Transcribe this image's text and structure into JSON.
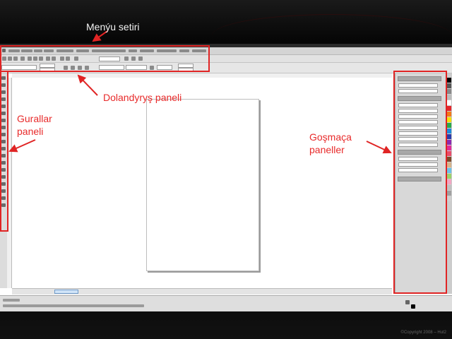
{
  "annotations": {
    "menu_label": "Menýu setiri",
    "toolbar_label": "Dolandyryş paneli",
    "toolbox_label_1": "Gurallar",
    "toolbox_label_2": "paneli",
    "dockers_label_1": "Goşmaça",
    "dockers_label_2": "paneller"
  },
  "colors": {
    "annotation_red": "#e02424",
    "background": "#000000"
  },
  "footer": {
    "copyright": "©Copyright 2008 – Hut2"
  }
}
